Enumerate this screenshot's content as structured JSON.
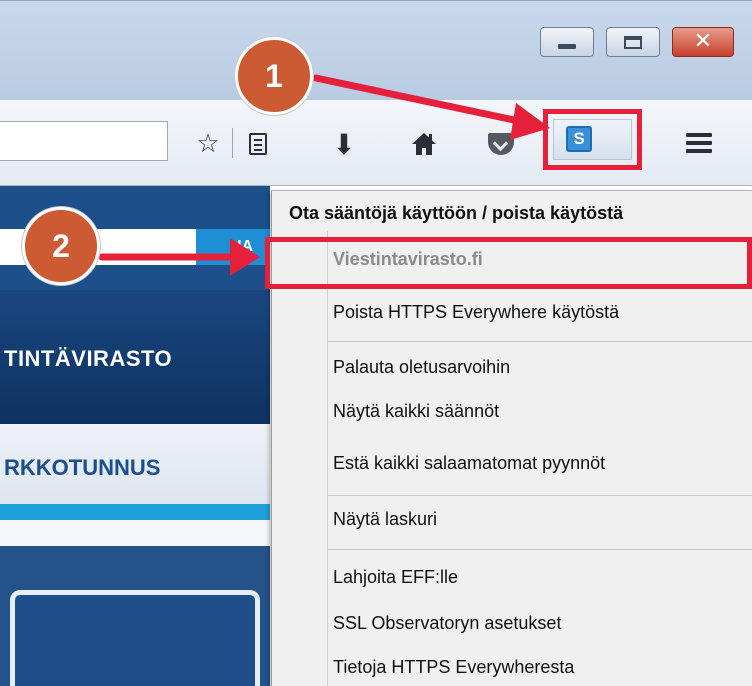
{
  "window": {
    "buttons": [
      {
        "name": "minimize",
        "icon": "minimize-icon"
      },
      {
        "name": "maximize",
        "icon": "maximize-icon"
      },
      {
        "name": "close",
        "icon": "close-icon",
        "glyph": "✕"
      }
    ]
  },
  "toolbar": {
    "icons": [
      "bookmark-star-icon",
      "reader-list-icon",
      "download-arrow-icon",
      "home-icon",
      "pocket-icon",
      "https-everywhere-s-icon",
      "hamburger-menu-icon"
    ],
    "star_glyph": "☆",
    "download_glyph": "⬇",
    "home_glyph": "⌂",
    "extension_letter": "S"
  },
  "page": {
    "search_button_partial": "HA",
    "banner_text": "TINTÄVIRASTO",
    "nav_text": "RKKOTUNNUS"
  },
  "menu": {
    "header": "Ota sääntöjä käyttöön / poista käytöstä",
    "items": [
      {
        "label": "Viestintavirasto.fi",
        "disabled": true
      },
      {
        "label": "Poista HTTPS Everywhere käytöstä"
      },
      {
        "label": "Palauta oletusarvoihin"
      },
      {
        "label": "Näytä kaikki säännöt"
      },
      {
        "label": "Estä kaikki salaamatomat pyynnöt"
      },
      {
        "label": "Näytä laskuri"
      },
      {
        "label": "Lahjoita EFF:lle"
      },
      {
        "label": "SSL Observatoryn asetukset"
      },
      {
        "label": "Tietoja HTTPS Everywheresta"
      }
    ]
  },
  "callouts": [
    {
      "number": "1"
    },
    {
      "number": "2"
    }
  ],
  "colors": {
    "highlight": "#e5203a",
    "callout": "#cc5b33",
    "site_blue": "#1d4f8a",
    "site_accent": "#1ea0dd"
  }
}
